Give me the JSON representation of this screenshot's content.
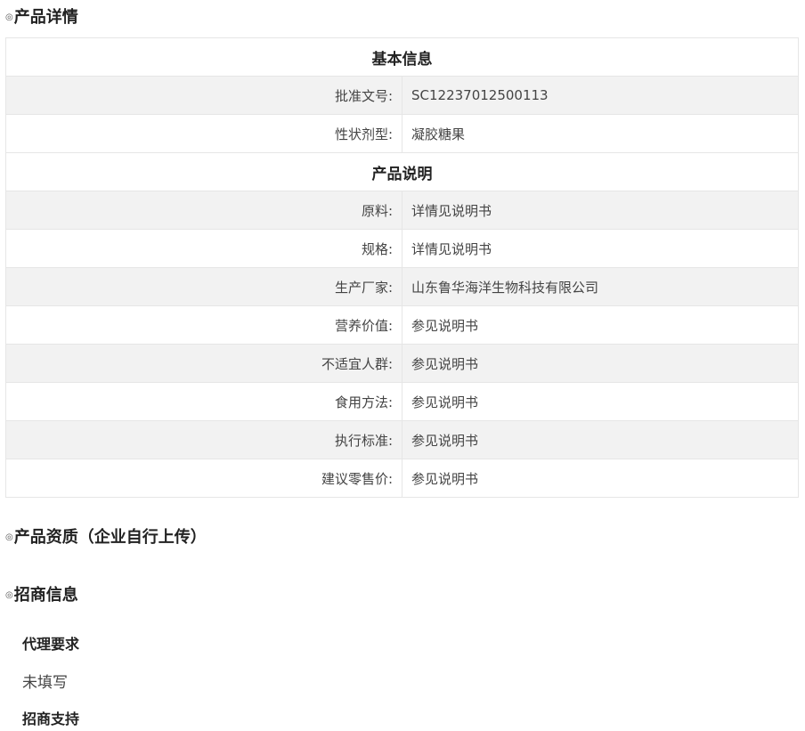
{
  "product_details": {
    "bullet": "◎",
    "title": "产品详情"
  },
  "basic_info": {
    "header": "基本信息",
    "rows": [
      {
        "label": "批准文号:",
        "value": "SC12237012500113"
      },
      {
        "label": "性状剂型:",
        "value": "凝胶糖果"
      }
    ]
  },
  "product_description": {
    "header": "产品说明",
    "rows": [
      {
        "label": "原料:",
        "value": "详情见说明书"
      },
      {
        "label": "规格:",
        "value": "详情见说明书"
      },
      {
        "label": "生产厂家:",
        "value": "山东鲁华海洋生物科技有限公司"
      },
      {
        "label": "营养价值:",
        "value": "参见说明书"
      },
      {
        "label": "不适宜人群:",
        "value": "参见说明书"
      },
      {
        "label": "食用方法:",
        "value": "参见说明书"
      },
      {
        "label": "执行标准:",
        "value": "参见说明书"
      },
      {
        "label": "建议零售价:",
        "value": "参见说明书"
      }
    ]
  },
  "qualification": {
    "bullet": "◎",
    "title": "产品资质（企业自行上传）"
  },
  "investment": {
    "bullet": "◎",
    "title": "招商信息",
    "agent_requirements_label": "代理要求",
    "agent_requirements_value": "未填写",
    "investment_support_label": "招商支持"
  },
  "colors": {
    "row_alt_bg": "#f2f2f2",
    "border": "#e6e6e6",
    "text": "#333333"
  }
}
